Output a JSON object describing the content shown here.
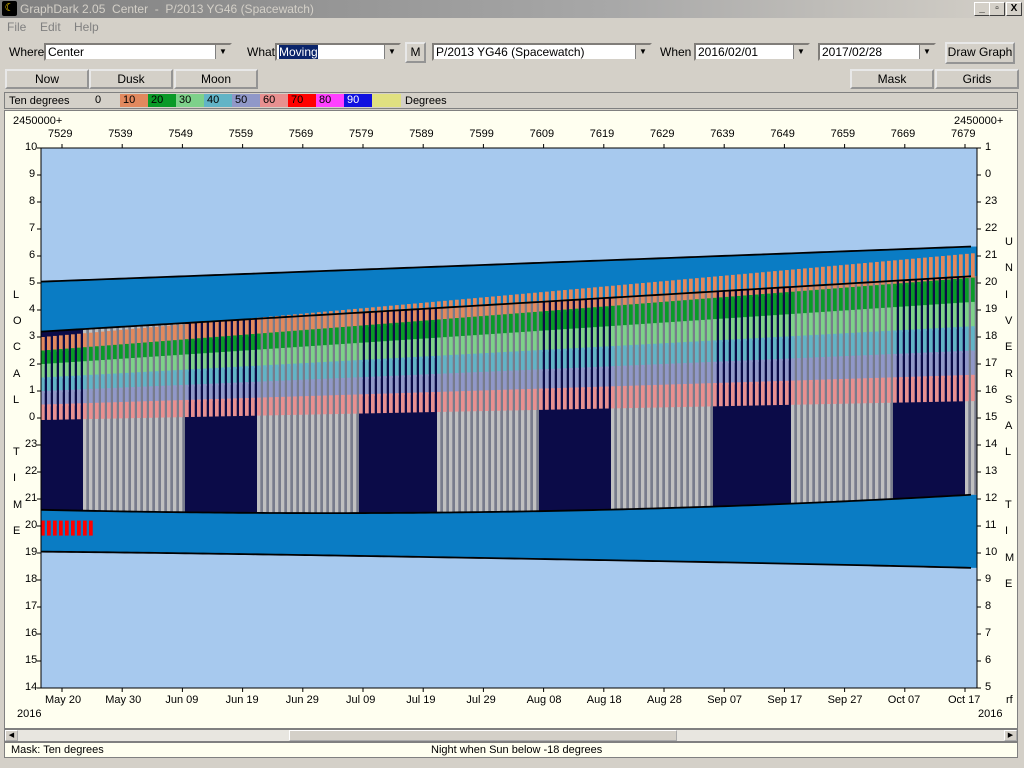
{
  "window": {
    "title": "GraphDark 2.05  Center  -  P/2013 YG46 (Spacewatch)",
    "app_icon": "moon-icon",
    "buttons": [
      "_",
      "▫",
      "X"
    ]
  },
  "menu": [
    "File",
    "Edit",
    "Help"
  ],
  "toolbar": {
    "where_label": "Where",
    "where_value": "Center",
    "what_label": "What",
    "what_value": "Moving",
    "m_button": "M",
    "object_value": "P/2013 YG46 (Spacewatch)",
    "when_label": "When",
    "start_date": "2016/02/01",
    "end_date": "2017/02/28",
    "draw_button": "Draw Graph"
  },
  "toolbar2": {
    "now": "Now",
    "dusk": "Dusk",
    "moon": "Moon",
    "mask": "Mask",
    "grids": "Grids"
  },
  "legend": {
    "label": "Ten degrees",
    "suffix": "Degrees",
    "items": [
      {
        "text": "0",
        "color": "#d4d0c8"
      },
      {
        "text": "10",
        "color": "#e2895e"
      },
      {
        "text": "20",
        "color": "#0a9a28"
      },
      {
        "text": "30",
        "color": "#7ed18a"
      },
      {
        "text": "40",
        "color": "#62b4c6"
      },
      {
        "text": "50",
        "color": "#9098c8"
      },
      {
        "text": "60",
        "color": "#e89090"
      },
      {
        "text": "70",
        "color": "#ff0000"
      },
      {
        "text": "80",
        "color": "#ff40ff"
      },
      {
        "text": "90",
        "color": "#1010e0"
      },
      {
        "text": "",
        "color": "#e0e080"
      }
    ]
  },
  "graph": {
    "jd_prefix": "2450000+",
    "jd_labels": [
      "7529",
      "7539",
      "7549",
      "7559",
      "7569",
      "7579",
      "7589",
      "7599",
      "7609",
      "7619",
      "7629",
      "7639",
      "7649",
      "7659",
      "7669",
      "7679"
    ],
    "left_hours": [
      "10",
      "9",
      "8",
      "7",
      "6",
      "5",
      "4",
      "3",
      "2",
      "1",
      "0",
      "23",
      "22",
      "21",
      "20",
      "19",
      "18",
      "17",
      "16",
      "15",
      "14"
    ],
    "right_hours": [
      "1",
      "0",
      "23",
      "22",
      "21",
      "20",
      "19",
      "18",
      "17",
      "16",
      "15",
      "14",
      "13",
      "12",
      "11",
      "10",
      "9",
      "8",
      "7",
      "6",
      "5"
    ],
    "left_title": [
      "L",
      "O",
      "C",
      "A",
      "L",
      "",
      "T",
      "I",
      "M",
      "E"
    ],
    "right_title": [
      "U",
      "N",
      "I",
      "V",
      "E",
      "R",
      "S",
      "A",
      "L",
      "",
      "T",
      "I",
      "M",
      "E"
    ],
    "date_labels": [
      "May 20",
      "May 30",
      "Jun 09",
      "Jun 19",
      "Jun 29",
      "Jul 09",
      "Jul 19",
      "Jul 29",
      "Aug 08",
      "Aug 18",
      "Aug 28",
      "Sep 07",
      "Sep 17",
      "Sep 27",
      "Oct 07",
      "Oct 17"
    ],
    "year_left": "2016",
    "year_right": "2016",
    "corner_mark": "rf",
    "colors": {
      "day": "#a7c9ee",
      "twilight": "#0a7cc4",
      "night": "#0b0b48",
      "moon_grey": "#c0c0c0"
    }
  },
  "status": {
    "mask": "Mask:  Ten degrees",
    "night": "Night when Sun below -18 degrees"
  }
}
